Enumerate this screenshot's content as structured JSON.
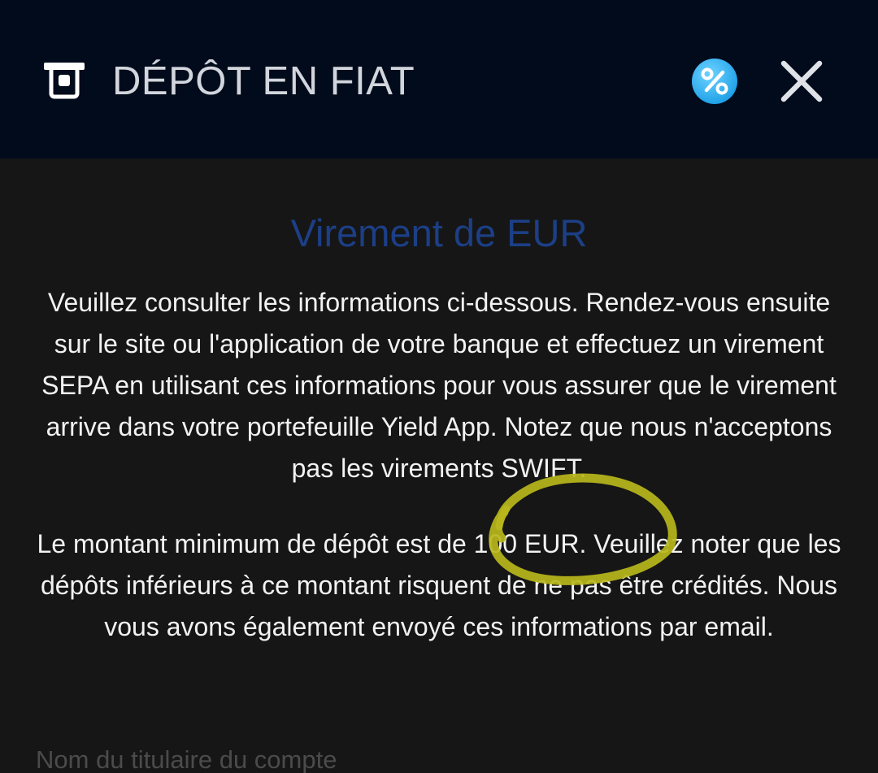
{
  "header": {
    "title": "DÉPÔT EN FIAT",
    "leading_icon": "deposit-terminal-icon",
    "promo_icon": "percent-badge-icon",
    "close_icon": "close-icon",
    "background_color": "#020b1c",
    "promo_color": "#29aef0"
  },
  "main": {
    "title": "Virement de EUR",
    "title_color": "#1c3f86",
    "paragraph1": "Veuillez consulter les informations ci-dessous. Rendez-vous ensuite sur le site ou l'application de votre banque et effectuez un virement SEPA en utilisant ces informations pour vous assurer que le virement arrive dans votre portefeuille Yield App. Notez que nous n'acceptons pas les virements SWIFT.",
    "paragraph2": "Le montant minimum de dépôt est de 100 EUR. Veuillez noter que les dépôts inférieurs à ce montant risquent de ne pas être crédités. Nous vous avons également envoyé ces informations par email.",
    "field_label": "Nom du titulaire du compte"
  },
  "annotation": {
    "type": "hand-drawn-circle",
    "color": "#b9b71c"
  }
}
